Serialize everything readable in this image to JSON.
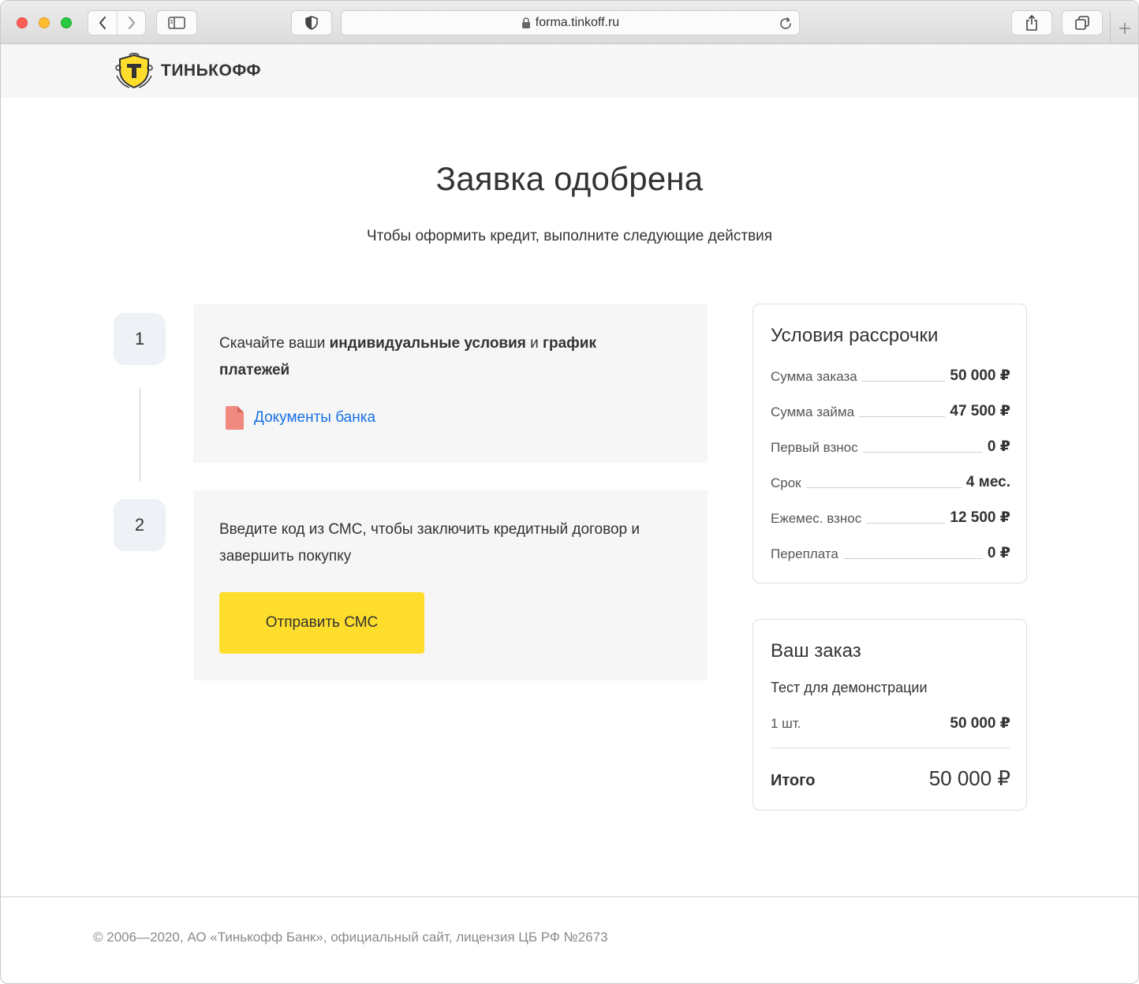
{
  "browser": {
    "url": "forma.tinkoff.ru"
  },
  "header": {
    "brand": "ТИНЬКОФФ"
  },
  "main": {
    "title": "Заявка одобрена",
    "subtitle": "Чтобы оформить кредит, выполните следующие действия",
    "steps": [
      {
        "number": "1",
        "text_pre": "Скачайте ваши ",
        "text_bold": "индивидуальные условия",
        "text_mid": " и ",
        "text_bold2": "график платежей",
        "link_label": "Документы банка"
      },
      {
        "number": "2",
        "text": "Введите код из СМС, чтобы заключить кредитный договор и завершить покупку",
        "button_label": "Отправить СМС"
      }
    ]
  },
  "terms": {
    "title": "Условия рассрочки",
    "rows": [
      {
        "label": "Сумма заказа",
        "value": "50 000 ₽"
      },
      {
        "label": "Сумма займа",
        "value": "47 500 ₽"
      },
      {
        "label": "Первый взнос",
        "value": "0 ₽"
      },
      {
        "label": "Срок",
        "value": "4 мес."
      },
      {
        "label": "Ежемес. взнос",
        "value": "12 500 ₽"
      },
      {
        "label": "Переплата",
        "value": "0 ₽"
      }
    ]
  },
  "order": {
    "title": "Ваш заказ",
    "item_name": "Тест для демонстрации",
    "qty": "1 шт.",
    "price": "50 000 ₽",
    "total_label": "Итого",
    "total_value": "50 000 ₽"
  },
  "footer": {
    "text": "© 2006—2020, АО «Тинькофф Банк», официальный сайт, лицензия ЦБ РФ №2673"
  },
  "colors": {
    "accent_yellow": "#ffdd2d",
    "link_blue": "#1771e6",
    "doc_icon": "#f08a80"
  }
}
